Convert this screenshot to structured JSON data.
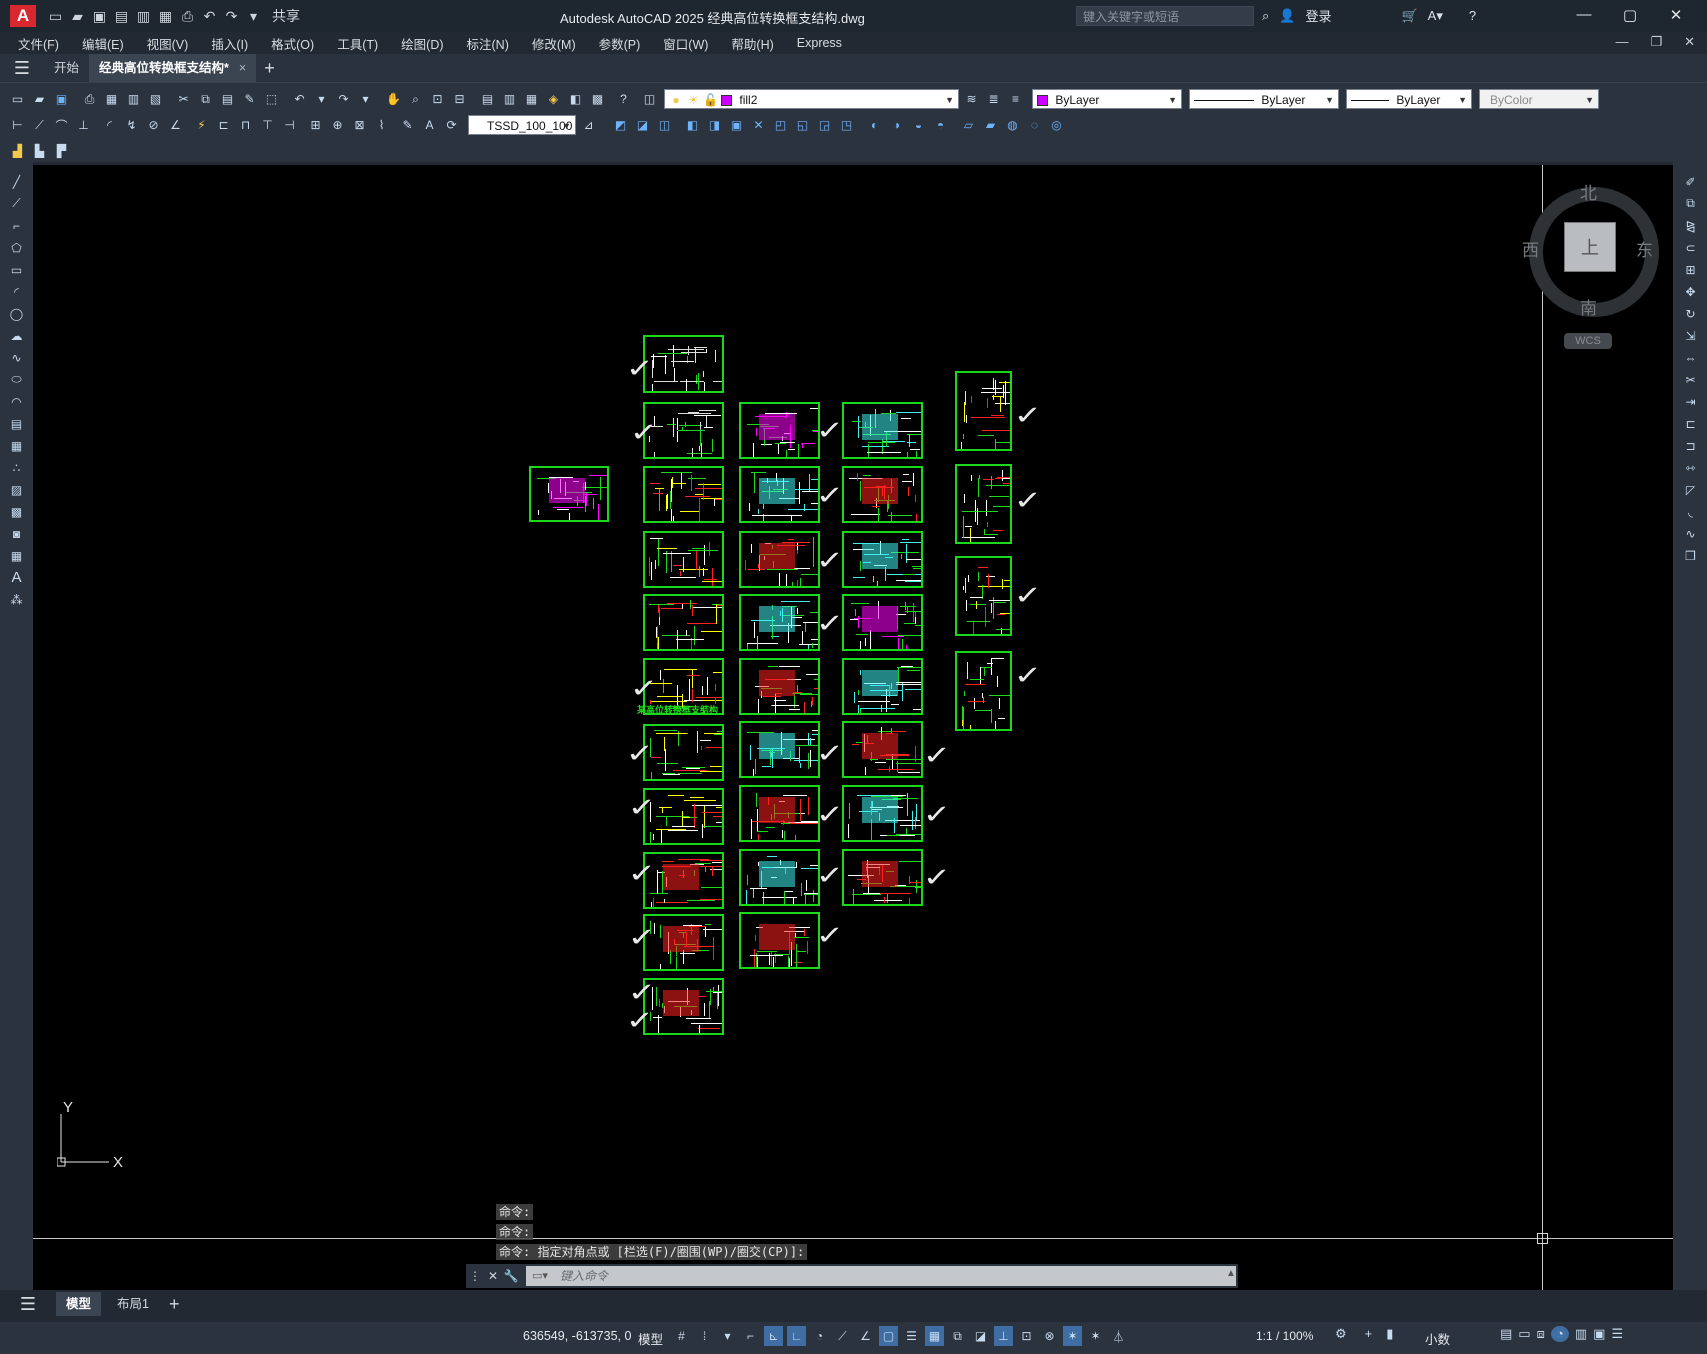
{
  "titlebar": {
    "app_letter": "A",
    "share_label": "共享",
    "title": "Autodesk AutoCAD 2025    经典高位转换框支结构.dwg",
    "search_placeholder": "键入关键字或短语",
    "login_label": "登录",
    "help_label": "?"
  },
  "menu": {
    "items": [
      "文件(F)",
      "编辑(E)",
      "视图(V)",
      "插入(I)",
      "格式(O)",
      "工具(T)",
      "绘图(D)",
      "标注(N)",
      "修改(M)",
      "参数(P)",
      "窗口(W)",
      "帮助(H)",
      "Express"
    ]
  },
  "tabs": {
    "start_label": "开始",
    "doc_label": "经典高位转换框支结构*",
    "close_glyph": "×",
    "add_glyph": "+"
  },
  "toolbar": {
    "layer_name": "fill2",
    "color_value": "ByLayer",
    "linetype_value": "ByLayer",
    "lineweight_value": "ByLayer",
    "plotstyle_value": "ByColor",
    "dimstyle_value": "TSSD_100_100",
    "layer_color": "#cc00ff"
  },
  "viewcube": {
    "north": "北",
    "south": "南",
    "west": "西",
    "east": "东",
    "face": "上",
    "wcs": "WCS"
  },
  "ucs": {
    "x": "X",
    "y": "Y"
  },
  "drawing_text": "某高位转换框支结构",
  "command": {
    "history": [
      "命令:",
      "命令:",
      "命令: 指定对角点或 [栏选(F)/圈围(WP)/圈交(CP)]:"
    ],
    "placeholder": "键入命令"
  },
  "layout_tabs": {
    "model": "模型",
    "layout1": "布局1",
    "add": "+"
  },
  "status": {
    "coordinates": "636549, -613735, 0",
    "space": "模型",
    "scale": "1:1 / 100%",
    "units": "小数"
  }
}
